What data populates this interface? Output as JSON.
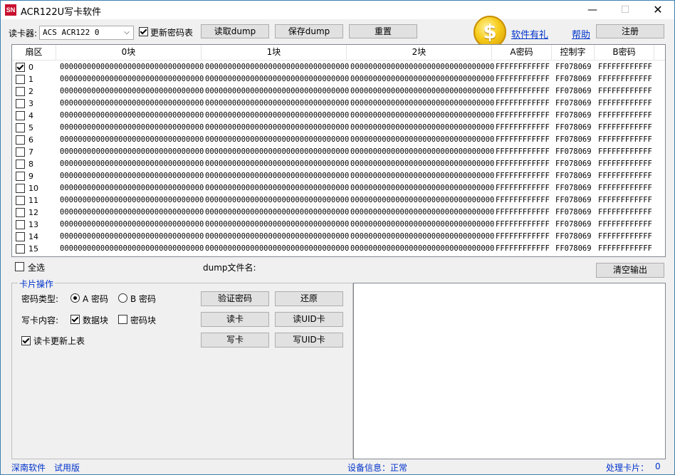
{
  "window": {
    "icon_text": "SN",
    "title": "ACR122U写卡软件",
    "min": "—",
    "max": "☐",
    "close": "✕"
  },
  "toolbar": {
    "reader_label": "读卡器:",
    "reader_value": "ACS ACR122 0",
    "update_keys_label": "更新密码表",
    "read_dump": "读取dump",
    "save_dump": "保存dump",
    "reset": "重置",
    "gift_link": "软件有礼",
    "help_link": "帮助",
    "register": "注册"
  },
  "table": {
    "headers": [
      "扇区",
      "0块",
      "1块",
      "2块",
      "A密码",
      "控制字",
      "B密码"
    ],
    "rows": [
      {
        "sector": "0",
        "checked": true,
        "b0": "00000000000000000000000000000000",
        "b1": "00000000000000000000000000000000",
        "b2": "00000000000000000000000000000000",
        "keyA": "FFFFFFFFFFFF",
        "access": "FF078069",
        "keyB": "FFFFFFFFFFFF"
      },
      {
        "sector": "1",
        "checked": false,
        "b0": "00000000000000000000000000000000",
        "b1": "00000000000000000000000000000000",
        "b2": "00000000000000000000000000000000",
        "keyA": "FFFFFFFFFFFF",
        "access": "FF078069",
        "keyB": "FFFFFFFFFFFF"
      },
      {
        "sector": "2",
        "checked": false,
        "b0": "00000000000000000000000000000000",
        "b1": "00000000000000000000000000000000",
        "b2": "00000000000000000000000000000000",
        "keyA": "FFFFFFFFFFFF",
        "access": "FF078069",
        "keyB": "FFFFFFFFFFFF"
      },
      {
        "sector": "3",
        "checked": false,
        "b0": "00000000000000000000000000000000",
        "b1": "00000000000000000000000000000000",
        "b2": "00000000000000000000000000000000",
        "keyA": "FFFFFFFFFFFF",
        "access": "FF078069",
        "keyB": "FFFFFFFFFFFF"
      },
      {
        "sector": "4",
        "checked": false,
        "b0": "00000000000000000000000000000000",
        "b1": "00000000000000000000000000000000",
        "b2": "00000000000000000000000000000000",
        "keyA": "FFFFFFFFFFFF",
        "access": "FF078069",
        "keyB": "FFFFFFFFFFFF"
      },
      {
        "sector": "5",
        "checked": false,
        "b0": "00000000000000000000000000000000",
        "b1": "00000000000000000000000000000000",
        "b2": "00000000000000000000000000000000",
        "keyA": "FFFFFFFFFFFF",
        "access": "FF078069",
        "keyB": "FFFFFFFFFFFF"
      },
      {
        "sector": "6",
        "checked": false,
        "b0": "00000000000000000000000000000000",
        "b1": "00000000000000000000000000000000",
        "b2": "00000000000000000000000000000000",
        "keyA": "FFFFFFFFFFFF",
        "access": "FF078069",
        "keyB": "FFFFFFFFFFFF"
      },
      {
        "sector": "7",
        "checked": false,
        "b0": "00000000000000000000000000000000",
        "b1": "00000000000000000000000000000000",
        "b2": "00000000000000000000000000000000",
        "keyA": "FFFFFFFFFFFF",
        "access": "FF078069",
        "keyB": "FFFFFFFFFFFF"
      },
      {
        "sector": "8",
        "checked": false,
        "b0": "00000000000000000000000000000000",
        "b1": "00000000000000000000000000000000",
        "b2": "00000000000000000000000000000000",
        "keyA": "FFFFFFFFFFFF",
        "access": "FF078069",
        "keyB": "FFFFFFFFFFFF"
      },
      {
        "sector": "9",
        "checked": false,
        "b0": "00000000000000000000000000000000",
        "b1": "00000000000000000000000000000000",
        "b2": "00000000000000000000000000000000",
        "keyA": "FFFFFFFFFFFF",
        "access": "FF078069",
        "keyB": "FFFFFFFFFFFF"
      },
      {
        "sector": "10",
        "checked": false,
        "b0": "00000000000000000000000000000000",
        "b1": "00000000000000000000000000000000",
        "b2": "00000000000000000000000000000000",
        "keyA": "FFFFFFFFFFFF",
        "access": "FF078069",
        "keyB": "FFFFFFFFFFFF"
      },
      {
        "sector": "11",
        "checked": false,
        "b0": "00000000000000000000000000000000",
        "b1": "00000000000000000000000000000000",
        "b2": "00000000000000000000000000000000",
        "keyA": "FFFFFFFFFFFF",
        "access": "FF078069",
        "keyB": "FFFFFFFFFFFF"
      },
      {
        "sector": "12",
        "checked": false,
        "b0": "00000000000000000000000000000000",
        "b1": "00000000000000000000000000000000",
        "b2": "00000000000000000000000000000000",
        "keyA": "FFFFFFFFFFFF",
        "access": "FF078069",
        "keyB": "FFFFFFFFFFFF"
      },
      {
        "sector": "13",
        "checked": false,
        "b0": "00000000000000000000000000000000",
        "b1": "00000000000000000000000000000000",
        "b2": "00000000000000000000000000000000",
        "keyA": "FFFFFFFFFFFF",
        "access": "FF078069",
        "keyB": "FFFFFFFFFFFF"
      },
      {
        "sector": "14",
        "checked": false,
        "b0": "00000000000000000000000000000000",
        "b1": "00000000000000000000000000000000",
        "b2": "00000000000000000000000000000000",
        "keyA": "FFFFFFFFFFFF",
        "access": "FF078069",
        "keyB": "FFFFFFFFFFFF"
      },
      {
        "sector": "15",
        "checked": false,
        "b0": "00000000000000000000000000000000",
        "b1": "00000000000000000000000000000000",
        "b2": "00000000000000000000000000000000",
        "keyA": "FFFFFFFFFFFF",
        "access": "FF078069",
        "keyB": "FFFFFFFFFFFF"
      }
    ]
  },
  "below_table": {
    "select_all": "全选",
    "dump_filename_label": "dump文件名:",
    "clear_output": "清空输出"
  },
  "card_ops": {
    "group_title": "卡片操作",
    "key_type_label": "密码类型:",
    "key_a": "A 密码",
    "key_b": "B 密码",
    "key_selected": "A",
    "verify": "验证密码",
    "restore": "还原",
    "write_content_label": "写卡内容:",
    "data_block": "数据块",
    "data_block_checked": true,
    "key_block": "密码块",
    "key_block_checked": false,
    "read_card": "读卡",
    "read_uid": "读UID卡",
    "refresh_table": "读卡更新上表",
    "refresh_table_checked": true,
    "write_card": "写卡",
    "write_uid": "写UID卡"
  },
  "statusbar": {
    "company": "深南软件",
    "edition": "试用版",
    "device_info": "设备信息：正常",
    "processed_cards": "处理卡片：",
    "processed_count": "0"
  },
  "colors": {
    "link": "#0033cc",
    "accent_red": "#c8102e",
    "coin": "#f7cc1c"
  }
}
